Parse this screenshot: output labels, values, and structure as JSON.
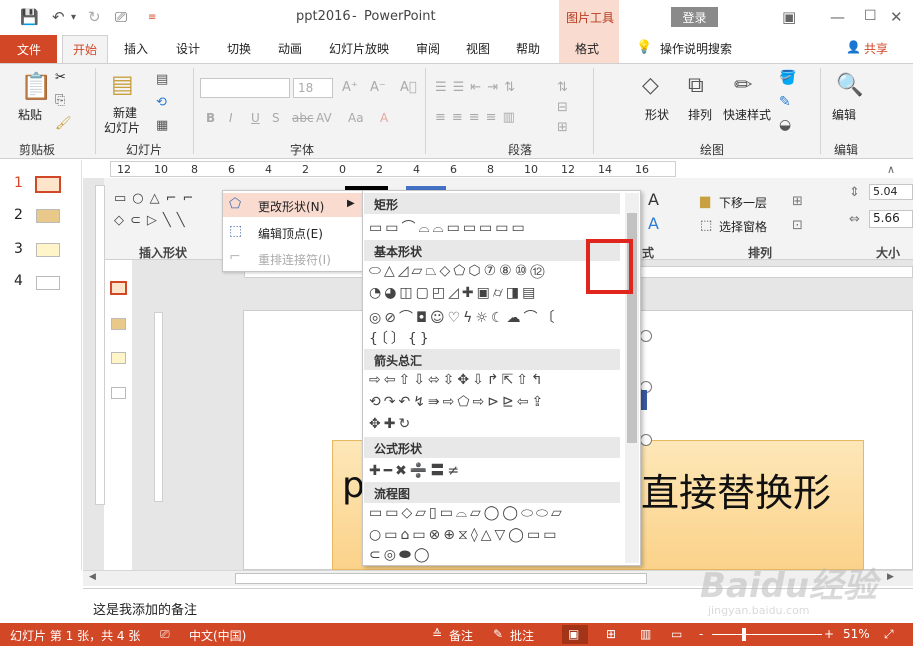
{
  "title": {
    "doc": "ppt2016",
    "sep": "-",
    "app": "PowerPoint",
    "context_tab": "图片工具",
    "login": "登录"
  },
  "tabs": [
    "文件",
    "开始",
    "插入",
    "设计",
    "切换",
    "动画",
    "幻灯片放映",
    "审阅",
    "视图",
    "帮助",
    "格式"
  ],
  "tellme": "操作说明搜索",
  "share": "共享",
  "ribbon": {
    "paste": "粘贴",
    "new_slide": "新建",
    "new_slide2": "幻灯片",
    "font_size": "18",
    "groups": [
      "剪贴板",
      "幻灯片",
      "字体",
      "段落",
      "绘图",
      "编辑"
    ],
    "shape": "形状",
    "arrange": "排列",
    "quick_style": "快速样式",
    "edit": "编辑"
  },
  "format": {
    "down_layer": "下移一层",
    "select_pane": "选择窗格",
    "group_arrange": "排列",
    "group_size": "大小",
    "insert_shapes": "插入形状",
    "style": "式",
    "w1": "5.04",
    "w2": "5.66"
  },
  "context_menu": {
    "change_shape": "更改形状(N)",
    "edit_points": "编辑顶点(E)",
    "reroute": "重排连接符(I)"
  },
  "gallery": {
    "sections": [
      "矩形",
      "基本形状",
      "箭头总汇",
      "公式形状",
      "流程图"
    ],
    "rect_row": "▭▭⌒⌓⌓▭▭▭▭▭",
    "basic_rows": [
      "⬭△◿▱⏢◇⬠⬡⑦⑧⑩⑫",
      "◔◕◫▢◰◿✚▣⌭◨▤",
      "◎⊘⌒◘☺♡ϟ☼☾☁⌒〔",
      "{〔〕{}"
    ],
    "arrow_rows": [
      "⇨⇦⇧⇩⬄⇳✥⇩↱⇱⇧↰",
      "⟲↷↶↯⇛⇨⬠⇨⊳⊵⇦⇪",
      "✥✚↻"
    ],
    "formula_row": "✚━✖➗〓≠",
    "flow_rows": [
      "▭▭◇▱▯▭⌓▱◯◯⬭⬭▱",
      "○▭⌂▭⊗⊕⧖◊△▽◯▭▭",
      "⊂◎⬬◯"
    ]
  },
  "slide_text": {
    "left": "p",
    "right": "直接替换形"
  },
  "thumbs": [
    {
      "num": "1"
    },
    {
      "num": "2"
    },
    {
      "num": "3"
    },
    {
      "num": "4"
    }
  ],
  "notes": "这是我添加的备注",
  "status": {
    "slide_info": "幻灯片 第 1 张，共 4 张",
    "lang": "中文(中国)",
    "notes_btn": "备注",
    "comments_btn": "批注",
    "zoom": "51%",
    "minus": "-",
    "plus": "+"
  },
  "ruler_numbers": [
    "12",
    "10",
    "8",
    "6",
    "4",
    "2",
    "0",
    "2",
    "4",
    "6",
    "8",
    "10",
    "12",
    "14",
    "16"
  ],
  "watermark": {
    "brand": "Baidu经验",
    "url": "jingyan.baidu.com"
  },
  "colors": {
    "accent": "#d24726",
    "highlight": "#e0261c",
    "context": "#f9dbd0"
  }
}
